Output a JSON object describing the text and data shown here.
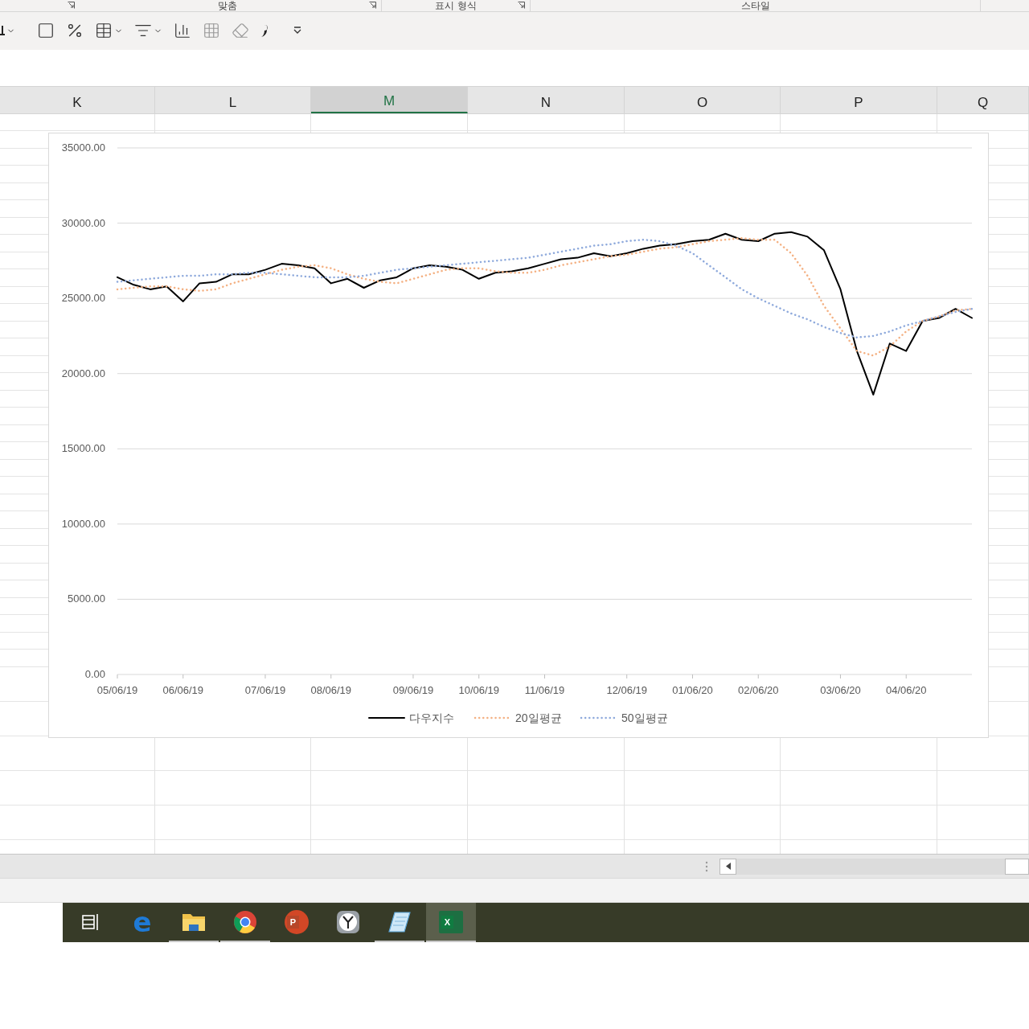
{
  "ribbon": {
    "groups": [
      {
        "label": "맞춤"
      },
      {
        "label": "표시 형식"
      },
      {
        "label": "스타일"
      }
    ]
  },
  "columns": [
    {
      "label": "K",
      "selected": false
    },
    {
      "label": "L",
      "selected": false
    },
    {
      "label": "M",
      "selected": true
    },
    {
      "label": "N",
      "selected": false
    },
    {
      "label": "O",
      "selected": false
    },
    {
      "label": "P",
      "selected": false
    },
    {
      "label": "Q",
      "selected": false
    }
  ],
  "chart": {
    "chart_data": {
      "type": "line",
      "categories": [
        "05/06/19",
        null,
        null,
        null,
        "06/06/19",
        null,
        null,
        null,
        null,
        "07/06/19",
        null,
        null,
        null,
        "08/06/19",
        null,
        null,
        null,
        null,
        "09/06/19",
        null,
        null,
        null,
        "10/06/19",
        null,
        null,
        null,
        "11/06/19",
        null,
        null,
        null,
        null,
        "12/06/19",
        null,
        null,
        null,
        "01/06/20",
        null,
        null,
        null,
        "02/06/20",
        null,
        null,
        null,
        null,
        "03/06/20",
        null,
        null,
        null,
        "04/06/20",
        null,
        null,
        null,
        null
      ],
      "grid": true,
      "legend": "bottom",
      "series": [
        {
          "name": "다우지수",
          "color": "#000000",
          "line_style": "solid",
          "values": [
            26400,
            25900,
            25600,
            25800,
            24800,
            26000,
            26100,
            26600,
            26600,
            26900,
            27300,
            27200,
            27000,
            26000,
            26300,
            25700,
            26200,
            26400,
            27000,
            27200,
            27100,
            26900,
            26300,
            26700,
            26800,
            27000,
            27300,
            27600,
            27700,
            28000,
            27800,
            28000,
            28300,
            28500,
            28600,
            28800,
            28900,
            29300,
            28900,
            28800,
            29300,
            29400,
            29100,
            28200,
            25600,
            21500,
            18600,
            22000,
            21500,
            23500,
            23700,
            24300,
            23700
          ]
        },
        {
          "name": "20일평균",
          "color": "#f4b183",
          "line_style": "dotted",
          "values": [
            25600,
            25700,
            25800,
            25800,
            25600,
            25500,
            25600,
            26000,
            26300,
            26600,
            26900,
            27100,
            27200,
            27000,
            26600,
            26300,
            26100,
            26000,
            26300,
            26600,
            26900,
            27000,
            27000,
            26800,
            26700,
            26700,
            26900,
            27200,
            27400,
            27600,
            27800,
            27900,
            28100,
            28300,
            28400,
            28600,
            28800,
            28900,
            29000,
            28900,
            28900,
            28000,
            26500,
            24500,
            23000,
            21500,
            21200,
            21800,
            22800,
            23500,
            23800,
            24200,
            24300
          ]
        },
        {
          "name": "50일평균",
          "color": "#8faadc",
          "line_style": "dotted",
          "values": [
            26100,
            26200,
            26300,
            26400,
            26500,
            26500,
            26600,
            26600,
            26700,
            26700,
            26600,
            26500,
            26400,
            26400,
            26400,
            26500,
            26700,
            26900,
            27000,
            27100,
            27200,
            27300,
            27400,
            27500,
            27600,
            27700,
            27900,
            28100,
            28300,
            28500,
            28600,
            28800,
            28900,
            28800,
            28500,
            28000,
            27200,
            26400,
            25600,
            25000,
            24500,
            24000,
            23600,
            23100,
            22700,
            22400,
            22500,
            22800,
            23200,
            23500,
            23800,
            24100,
            24300
          ]
        }
      ],
      "ylim": [
        0,
        35000
      ],
      "yticks": [
        {
          "value": 0,
          "label": "0.00"
        },
        {
          "value": 5000,
          "label": "5000.00"
        },
        {
          "value": 10000,
          "label": "10000.00"
        },
        {
          "value": 15000,
          "label": "15000.00"
        },
        {
          "value": 20000,
          "label": "20000.00"
        },
        {
          "value": 25000,
          "label": "25000.00"
        },
        {
          "value": 30000,
          "label": "30000.00"
        },
        {
          "value": 35000,
          "label": "35000.00"
        }
      ]
    }
  },
  "taskbar": [
    {
      "kind": "taskview",
      "running": false,
      "selected": false
    },
    {
      "kind": "edge",
      "glyph": "e",
      "running": false,
      "selected": false
    },
    {
      "kind": "folder",
      "running": true,
      "selected": false
    },
    {
      "kind": "chrome",
      "running": true,
      "selected": false
    },
    {
      "kind": "powerpoint",
      "glyph": "P",
      "running": false,
      "selected": false
    },
    {
      "kind": "clock",
      "running": false,
      "selected": false
    },
    {
      "kind": "notepad",
      "running": true,
      "selected": false
    },
    {
      "kind": "excel",
      "glyph": "X",
      "running": true,
      "selected": true
    }
  ]
}
